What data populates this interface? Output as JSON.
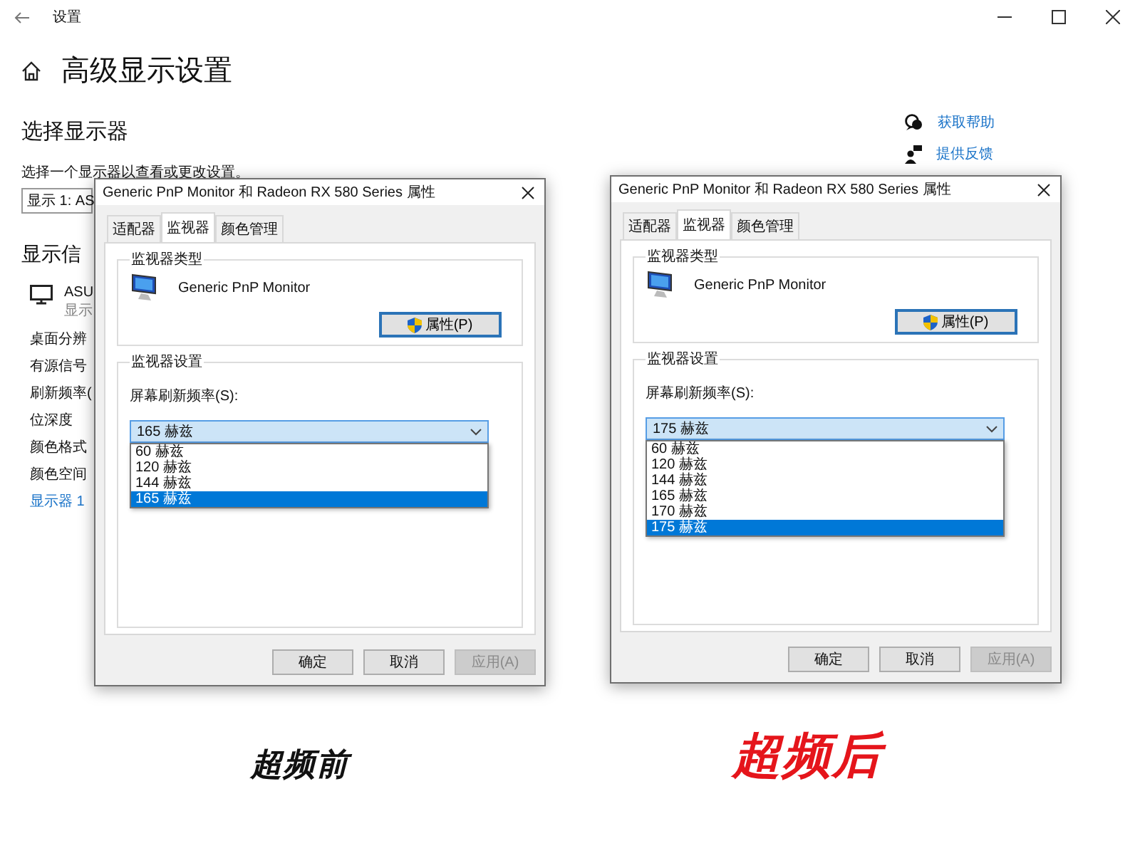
{
  "window": {
    "title": "设置"
  },
  "page": {
    "title": "高级显示设置"
  },
  "section": {
    "title": "选择显示器",
    "hint": "选择一个显示器以查看或更改设置。",
    "display_select": {
      "value": "显示 1: AS"
    }
  },
  "info": {
    "title": "显示信",
    "monitor_name": "ASU",
    "monitor_sub": "显示",
    "rows": [
      "桌面分辨",
      "有源信号",
      "刷新频率(",
      "位深度",
      "颜色格式",
      "颜色空间"
    ],
    "link": "显示器 1"
  },
  "side_links": [
    {
      "kind": "help",
      "label": "获取帮助"
    },
    {
      "kind": "feedback",
      "label": "提供反馈"
    }
  ],
  "dialogs": [
    {
      "title": "Generic PnP Monitor 和 Radeon RX 580 Series 属性",
      "tabs": [
        {
          "label": "适配器",
          "selected": false
        },
        {
          "label": "监视器",
          "selected": true
        },
        {
          "label": "颜色管理",
          "selected": false
        }
      ],
      "type_group": "监视器类型",
      "monitor": "Generic PnP Monitor",
      "properties_button": "属性(P)",
      "settings_group": "监视器设置",
      "rate_label": "屏幕刷新频率(S):",
      "rate_value": "165 赫兹",
      "options": [
        {
          "label": "60 赫兹",
          "selected": false
        },
        {
          "label": "120 赫兹",
          "selected": false
        },
        {
          "label": "144 赫兹",
          "selected": false
        },
        {
          "label": "165 赫兹",
          "selected": true
        }
      ],
      "buttons": [
        {
          "label": "确定",
          "disabled": false
        },
        {
          "label": "取消",
          "disabled": false
        },
        {
          "label": "应用(A)",
          "disabled": true
        }
      ],
      "caption": {
        "text": "超频前",
        "color": "#111111",
        "emphasis": false
      }
    },
    {
      "title": "Generic PnP Monitor 和 Radeon RX 580 Series 属性",
      "tabs": [
        {
          "label": "适配器",
          "selected": false
        },
        {
          "label": "监视器",
          "selected": true
        },
        {
          "label": "颜色管理",
          "selected": false
        }
      ],
      "type_group": "监视器类型",
      "monitor": "Generic PnP Monitor",
      "properties_button": "属性(P)",
      "settings_group": "监视器设置",
      "rate_label": "屏幕刷新频率(S):",
      "rate_value": "175 赫兹",
      "options": [
        {
          "label": "60 赫兹",
          "selected": false
        },
        {
          "label": "120 赫兹",
          "selected": false
        },
        {
          "label": "144 赫兹",
          "selected": false
        },
        {
          "label": "165 赫兹",
          "selected": false
        },
        {
          "label": "170 赫兹",
          "selected": false
        },
        {
          "label": "175 赫兹",
          "selected": true
        }
      ],
      "buttons": [
        {
          "label": "确定",
          "disabled": false
        },
        {
          "label": "取消",
          "disabled": false
        },
        {
          "label": "应用(A)",
          "disabled": true
        }
      ],
      "caption": {
        "text": "超频后",
        "color": "#e5151b",
        "emphasis": true
      }
    }
  ]
}
